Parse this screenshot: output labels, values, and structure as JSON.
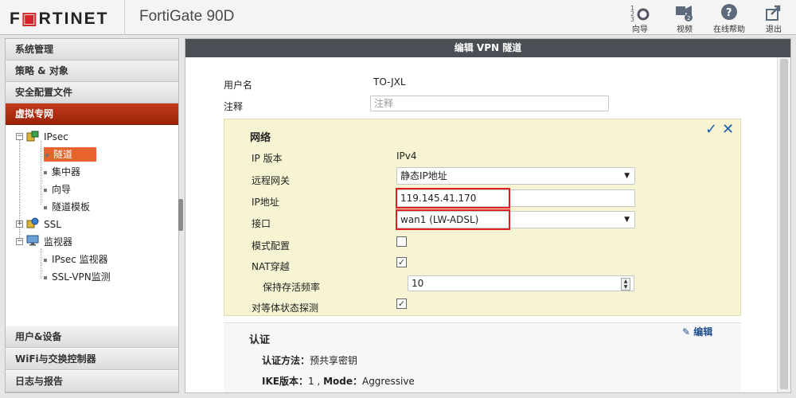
{
  "header": {
    "logo_prefix": "F",
    "logo_rest": "RTINET",
    "product": "FortiGate 90D",
    "buttons": [
      {
        "label": "向导",
        "icon": "wizard-icon"
      },
      {
        "label": "视频",
        "icon": "video-icon"
      },
      {
        "label": "在线帮助",
        "icon": "help-icon"
      },
      {
        "label": "退出",
        "icon": "logout-icon"
      }
    ]
  },
  "sidebar": {
    "top_menus": [
      "系统管理",
      "策略 & 对象",
      "安全配置文件",
      "虚拟专网"
    ],
    "tree": {
      "ipsec": "IPsec",
      "ipsec_children": [
        "隧道",
        "集中器",
        "向导",
        "隧道模板"
      ],
      "ssl": "SSL",
      "monitor": "监视器",
      "monitor_children": [
        "IPsec 监视器",
        "SSL-VPN监测"
      ]
    },
    "bottom_menus": [
      "用户&设备",
      "WiFi与交换控制器",
      "日志与报告"
    ]
  },
  "main": {
    "title": "编辑 VPN 隧道",
    "name_label": "用户名",
    "name_value": "TO-JXL",
    "comment_label": "注释",
    "comment_placeholder": "注释",
    "network": {
      "title": "网络",
      "ip_version_label": "IP 版本",
      "ip_version_value": "IPv4",
      "remote_gw_label": "远程网关",
      "remote_gw_value": "静态IP地址",
      "ip_label": "IP地址",
      "ip_value": "119.145.41.170",
      "interface_label": "接口",
      "interface_value": "wan1 (LW-ADSL)",
      "mode_cfg_label": "模式配置",
      "mode_cfg_checked": false,
      "nat_label": "NAT穿越",
      "nat_checked": true,
      "keepalive_label": "保持存活频率",
      "keepalive_value": "10",
      "dpd_label": "对等体状态探测",
      "dpd_checked": true,
      "confirm_glyph": "✓",
      "cancel_glyph": "✕"
    },
    "auth": {
      "title": "认证",
      "edit_label": "编辑",
      "method_key": "认证方法：",
      "method_value": "预共享密钥",
      "ike_key": "IKE版本：",
      "ike_value": "1",
      "mode_key": "Mode：",
      "mode_value": "Aggressive"
    }
  }
}
